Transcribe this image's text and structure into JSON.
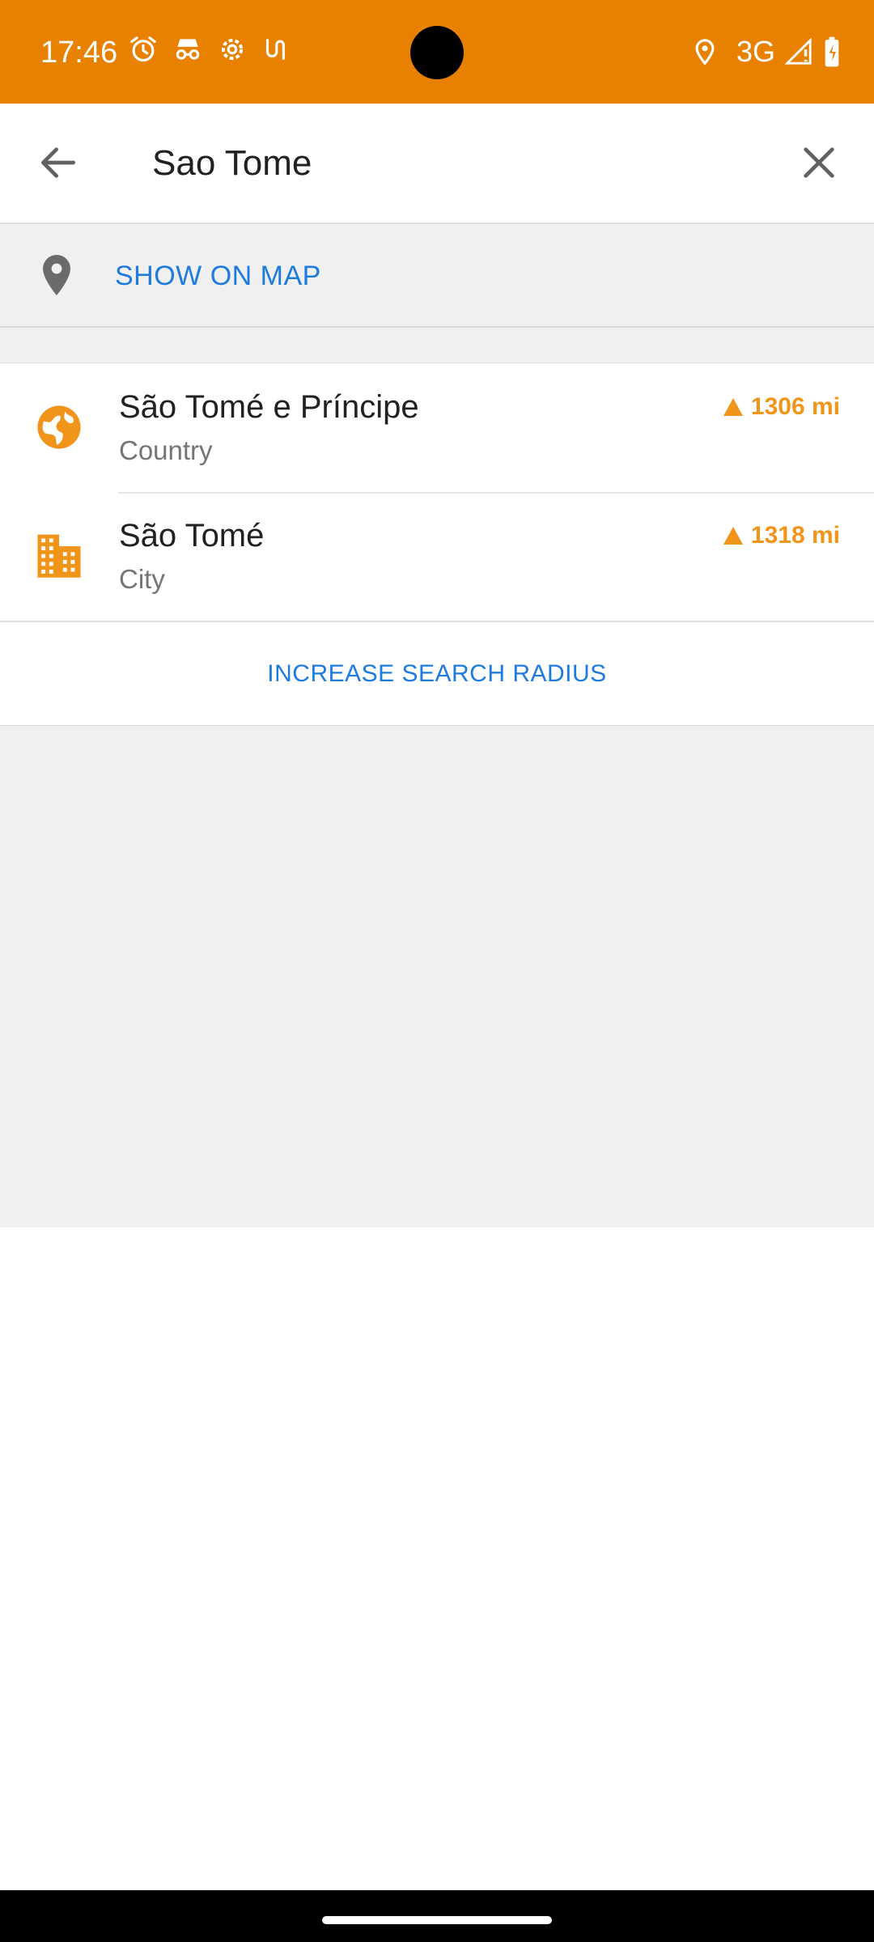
{
  "status_bar": {
    "time": "17:46",
    "network": "3G",
    "background_color": "#E88100",
    "left_icons": [
      "alarm-icon",
      "incognito-icon",
      "settings-gear-icon",
      "route-icon"
    ],
    "right_icons": [
      "location-icon",
      "signal-icon",
      "battery-charging-icon"
    ]
  },
  "search": {
    "query": "Sao Tome",
    "back_icon": "arrow-left-icon",
    "clear_icon": "close-icon"
  },
  "show_on_map": {
    "label": "SHOW ON MAP",
    "icon": "map-pin-icon"
  },
  "results": [
    {
      "name": "São Tomé e Príncipe",
      "type": "Country",
      "distance": "1306 mi",
      "icon": "globe-icon"
    },
    {
      "name": "São Tomé",
      "type": "City",
      "distance": "1318 mi",
      "icon": "city-buildings-icon"
    }
  ],
  "increase_radius": {
    "label": "INCREASE SEARCH RADIUS"
  },
  "colors": {
    "accent": "#E88100",
    "link": "#1E7BE0",
    "result_icon": "#F0951A"
  }
}
